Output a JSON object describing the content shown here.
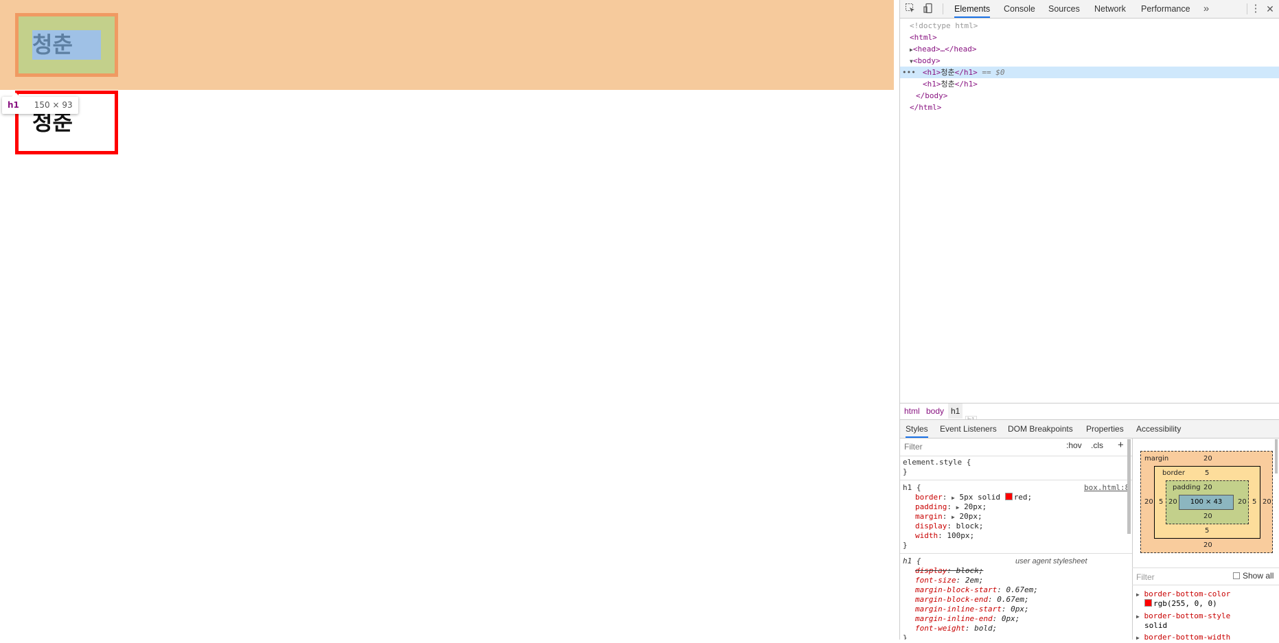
{
  "page": {
    "heading_first": "청춘",
    "heading_second": "청춘",
    "tooltip": {
      "tag": "h1",
      "dimensions": "150 × 93"
    }
  },
  "devtools": {
    "toolbar_icons": [
      "inspect-icon",
      "device-toolbar-icon",
      "more-tabs-icon",
      "kebab-menu-icon",
      "close-icon"
    ],
    "tabs": [
      "Elements",
      "Console",
      "Sources",
      "Network",
      "Performance"
    ],
    "active_tab": "Elements",
    "overflow_symbol": "»",
    "kebab_symbol": "⋮",
    "close_symbol": "✕",
    "dom": {
      "doctype": "<!doctype html>",
      "html_open": "<html>",
      "head": "<head>…</head>",
      "body_open": "<body>",
      "h1_first_text": "청춘",
      "h1_second_text": "청춘",
      "h1_open": "<h1>",
      "h1_close": "</h1>",
      "selected_marker": "== $0",
      "dots": "•••",
      "body_close": "</body>",
      "html_close": "</html>"
    },
    "breadcrumbs": [
      "html",
      "body",
      "h1"
    ],
    "breadcrumb_hover": "h1",
    "sub_tabs": [
      "Styles",
      "Event Listeners",
      "DOM Breakpoints",
      "Properties",
      "Accessibility"
    ],
    "styles": {
      "filter_placeholder": "Filter",
      "hov": ":hov",
      "cls": ".cls",
      "plus": "+",
      "element_style_selector": "element.style {",
      "close_brace": "}",
      "rule1_selector": "h1 {",
      "rule1_source": "box.html:8",
      "rule1_props": [
        {
          "name": "border",
          "value": "5px solid",
          "extra": "red;",
          "swatch": "#ff0000",
          "expandable": true
        },
        {
          "name": "padding",
          "value": "20px;",
          "expandable": true
        },
        {
          "name": "margin",
          "value": "20px;",
          "expandable": true
        },
        {
          "name": "display",
          "value": "block;",
          "expandable": false
        },
        {
          "name": "width",
          "value": "100px;",
          "expandable": false
        }
      ],
      "rule2_selector": "h1 {",
      "rule2_source": "user agent stylesheet",
      "rule2_props": [
        {
          "name": "display",
          "value": "block;",
          "struck": true
        },
        {
          "name": "font-size",
          "value": "2em;"
        },
        {
          "name": "margin-block-start",
          "value": "0.67em;"
        },
        {
          "name": "margin-block-end",
          "value": "0.67em;"
        },
        {
          "name": "margin-inline-start",
          "value": "0px;"
        },
        {
          "name": "margin-inline-end",
          "value": "0px;"
        },
        {
          "name": "font-weight",
          "value": "bold;"
        }
      ]
    },
    "box_model": {
      "margin_label": "margin",
      "border_label": "border",
      "padding_label": "padding",
      "margin": {
        "top": "20",
        "right": "20",
        "bottom": "20",
        "left": "20"
      },
      "border": {
        "top": "5",
        "right": "5",
        "bottom": "5",
        "left": "5"
      },
      "padding": {
        "top": "20",
        "right": "20",
        "bottom": "20",
        "left": "20"
      },
      "content": "100 × 43"
    },
    "computed": {
      "filter_placeholder": "Filter",
      "show_all_label": "Show all",
      "props": [
        {
          "name": "border-bottom-color",
          "value": "rgb(255, 0, 0)",
          "swatch": "#ff0000"
        },
        {
          "name": "border-bottom-style",
          "value": "solid"
        },
        {
          "name": "border-bottom-width",
          "value": ""
        }
      ]
    }
  },
  "colors": {
    "margin_highlight": "#f6ca9c",
    "border_highlight": "#f09a62",
    "padding_highlight": "#c3d08b",
    "content_highlight": "#9fc1e6",
    "border_red": "#ff0000",
    "accent": "#1a73e8"
  }
}
